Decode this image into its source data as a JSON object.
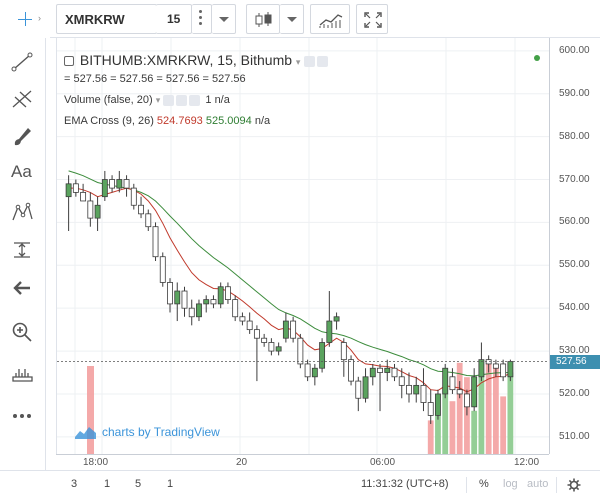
{
  "toolbar": {
    "symbol": "XMRKRW",
    "interval": "15"
  },
  "legend": {
    "title": "BITHUMB:XMRKRW, 15, Bithumb",
    "ohlc": "= 527.56 = 527.56 = 527.56 = 527.56",
    "volume_label": "Volume (false, 20)",
    "volume_value": "1",
    "volume_extra": "n/a",
    "ema_label": "EMA Cross (9, 26)",
    "ema_fast": "524.7693",
    "ema_slow": "525.0094",
    "ema_extra": "n/a"
  },
  "sidebar": {
    "text_tool": "Aa"
  },
  "price_axis": {
    "labels": [
      "600.00",
      "590.00",
      "580.00",
      "570.00",
      "560.00",
      "550.00",
      "540.00",
      "530.00",
      "520.00",
      "510.00"
    ],
    "last_price": "527.56"
  },
  "time_axis": {
    "labels": [
      "18:00",
      "20",
      "06:00",
      "12:00"
    ]
  },
  "bottombar": {
    "ranges": [
      "3",
      "1",
      "5",
      "1"
    ],
    "clock": "11:31:32 (UTC+8)",
    "percent": "%",
    "log": "log",
    "auto": "auto"
  },
  "watermark": "charts by TradingView",
  "colors": {
    "up": "#5aa35e",
    "down": "#c0392b",
    "ema_fast": "#c0392b",
    "ema_slow": "#3c8c3c",
    "vol_up": "#88c98b",
    "vol_down": "#f3a0a0",
    "accent": "#3b94d9"
  },
  "chart_data": {
    "type": "candlestick",
    "ylim": [
      506,
      603
    ],
    "candles": [
      {
        "o": 566,
        "h": 571,
        "l": 558,
        "c": 569
      },
      {
        "o": 569,
        "h": 570,
        "l": 566,
        "c": 567
      },
      {
        "o": 567,
        "h": 569,
        "l": 565,
        "c": 565
      },
      {
        "o": 565,
        "h": 567,
        "l": 559,
        "c": 561
      },
      {
        "o": 561,
        "h": 566,
        "l": 558,
        "c": 564
      },
      {
        "o": 566,
        "h": 572,
        "l": 565,
        "c": 570
      },
      {
        "o": 570,
        "h": 571,
        "l": 567,
        "c": 568
      },
      {
        "o": 568,
        "h": 572,
        "l": 567,
        "c": 570
      },
      {
        "o": 570,
        "h": 571,
        "l": 566,
        "c": 568
      },
      {
        "o": 568,
        "h": 569,
        "l": 563,
        "c": 564
      },
      {
        "o": 564,
        "h": 566,
        "l": 561,
        "c": 562
      },
      {
        "o": 562,
        "h": 563,
        "l": 558,
        "c": 559
      },
      {
        "o": 559,
        "h": 560,
        "l": 551,
        "c": 552
      },
      {
        "o": 552,
        "h": 553,
        "l": 545,
        "c": 546
      },
      {
        "o": 546,
        "h": 547,
        "l": 539,
        "c": 541
      },
      {
        "o": 541,
        "h": 546,
        "l": 537,
        "c": 544
      },
      {
        "o": 544,
        "h": 545,
        "l": 538,
        "c": 540
      },
      {
        "o": 540,
        "h": 542,
        "l": 536,
        "c": 538
      },
      {
        "o": 538,
        "h": 542,
        "l": 537,
        "c": 541
      },
      {
        "o": 541,
        "h": 543,
        "l": 539,
        "c": 542
      },
      {
        "o": 542,
        "h": 543,
        "l": 540,
        "c": 541
      },
      {
        "o": 541,
        "h": 546,
        "l": 540,
        "c": 545
      },
      {
        "o": 545,
        "h": 546,
        "l": 541,
        "c": 542
      },
      {
        "o": 542,
        "h": 543,
        "l": 537,
        "c": 538
      },
      {
        "o": 538,
        "h": 539,
        "l": 536,
        "c": 537
      },
      {
        "o": 537,
        "h": 539,
        "l": 534,
        "c": 535
      },
      {
        "o": 535,
        "h": 536,
        "l": 523,
        "c": 533
      },
      {
        "o": 533,
        "h": 534,
        "l": 531,
        "c": 532
      },
      {
        "o": 532,
        "h": 533,
        "l": 529,
        "c": 530
      },
      {
        "o": 530,
        "h": 532,
        "l": 529,
        "c": 531
      },
      {
        "o": 533,
        "h": 539,
        "l": 532,
        "c": 537
      },
      {
        "o": 537,
        "h": 538,
        "l": 532,
        "c": 533
      },
      {
        "o": 533,
        "h": 534,
        "l": 526,
        "c": 527
      },
      {
        "o": 527,
        "h": 528,
        "l": 523,
        "c": 524
      },
      {
        "o": 524,
        "h": 527,
        "l": 522,
        "c": 526
      },
      {
        "o": 526,
        "h": 533,
        "l": 525,
        "c": 532
      },
      {
        "o": 532,
        "h": 544,
        "l": 531,
        "c": 537
      },
      {
        "o": 537,
        "h": 539,
        "l": 535,
        "c": 538
      },
      {
        "o": 532,
        "h": 533,
        "l": 524,
        "c": 528
      },
      {
        "o": 528,
        "h": 529,
        "l": 522,
        "c": 523
      },
      {
        "o": 523,
        "h": 524,
        "l": 516,
        "c": 519
      },
      {
        "o": 519,
        "h": 526,
        "l": 518,
        "c": 524
      },
      {
        "o": 524,
        "h": 527,
        "l": 522,
        "c": 526
      },
      {
        "o": 526,
        "h": 527,
        "l": 516,
        "c": 525
      },
      {
        "o": 525,
        "h": 528,
        "l": 523,
        "c": 526
      },
      {
        "o": 526,
        "h": 527,
        "l": 523,
        "c": 524
      },
      {
        "o": 524,
        "h": 526,
        "l": 519,
        "c": 522
      },
      {
        "o": 522,
        "h": 525,
        "l": 518,
        "c": 520
      },
      {
        "o": 520,
        "h": 524,
        "l": 518,
        "c": 522
      },
      {
        "o": 522,
        "h": 526,
        "l": 516,
        "c": 518
      },
      {
        "o": 518,
        "h": 521,
        "l": 513,
        "c": 515
      },
      {
        "o": 515,
        "h": 521,
        "l": 514,
        "c": 520
      },
      {
        "o": 520,
        "h": 527,
        "l": 519,
        "c": 526
      },
      {
        "o": 524,
        "h": 526,
        "l": 520,
        "c": 521
      },
      {
        "o": 521,
        "h": 523,
        "l": 519,
        "c": 520
      },
      {
        "o": 520,
        "h": 521,
        "l": 515,
        "c": 517
      },
      {
        "o": 517,
        "h": 526,
        "l": 516,
        "c": 524
      },
      {
        "o": 524,
        "h": 532,
        "l": 523,
        "c": 528
      },
      {
        "o": 528,
        "h": 529,
        "l": 525,
        "c": 527
      },
      {
        "o": 527,
        "h": 528,
        "l": 524,
        "c": 526
      },
      {
        "o": 527,
        "h": 528,
        "l": 523,
        "c": 524
      },
      {
        "o": 524,
        "h": 528,
        "l": 523,
        "c": 527.56
      }
    ],
    "ema_fast": [
      568,
      568,
      567.6,
      567,
      566,
      566.5,
      567,
      567.5,
      568,
      567.5,
      566.6,
      565,
      562.8,
      559.8,
      556.4,
      553.5,
      550.8,
      548.3,
      546.6,
      545.5,
      544.6,
      544.5,
      544,
      542.9,
      541.7,
      540.3,
      538.8,
      537.5,
      536,
      535,
      535.4,
      534.9,
      533.3,
      531.4,
      530.3,
      530.6,
      531.8,
      533,
      532,
      530.2,
      528,
      527,
      526.8,
      526.5,
      526.4,
      526,
      525.2,
      524.3,
      523.8,
      522.6,
      521,
      520.8,
      521.9,
      521.7,
      521.4,
      520.5,
      521.2,
      522.6,
      523.5,
      524,
      524.1,
      524.77
    ],
    "ema_slow": [
      572,
      571.5,
      570.9,
      570.1,
      569.3,
      568.9,
      568.6,
      568.3,
      568,
      567.6,
      567,
      566.2,
      565,
      563.3,
      561.5,
      559.8,
      558,
      556.2,
      554.6,
      553.2,
      551.8,
      550.6,
      549.4,
      548,
      546.6,
      545.2,
      543.8,
      542.4,
      541,
      539.7,
      538.9,
      538.3,
      537.5,
      536.4,
      535.3,
      534.5,
      534.2,
      534,
      533.6,
      533,
      532.2,
      531.5,
      530.9,
      530.4,
      529.9,
      529.3,
      528.7,
      528,
      527.5,
      526.8,
      525.9,
      525.3,
      525.2,
      525,
      524.7,
      524.3,
      524.2,
      524.5,
      524.7,
      524.9,
      524.95,
      525.01
    ],
    "volumes": [
      0,
      0,
      0,
      0,
      0,
      0,
      0,
      0,
      0,
      0,
      0,
      0,
      0,
      0,
      0,
      0,
      0,
      0,
      0,
      0,
      0,
      0,
      0,
      0,
      0,
      0,
      0,
      0,
      0,
      0,
      0,
      0,
      0,
      0,
      0,
      0,
      0,
      0,
      0,
      0,
      0,
      0,
      0,
      0,
      0,
      0,
      0,
      0,
      0,
      0,
      0.35,
      0.4,
      0.7,
      0.55,
      0.95,
      0.8,
      0.45,
      0.85,
      0.95,
      0.9,
      0.6,
      0.85
    ]
  }
}
